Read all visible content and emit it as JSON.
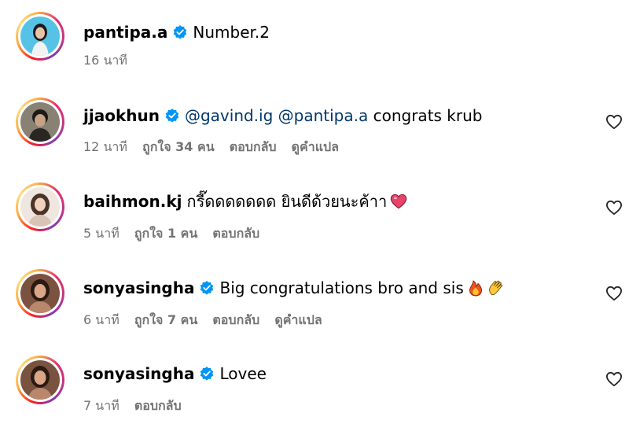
{
  "comments": [
    {
      "username": "pantipa.a",
      "verified": true,
      "mentions": [],
      "text": "Number.2",
      "time": "16 นาที",
      "likes": "",
      "reply": "",
      "translate": "",
      "has_heart": false
    },
    {
      "username": "jjaokhun",
      "verified": true,
      "mention1": "@gavind.ig",
      "mention2": "@pantipa.a",
      "text": "congrats krub",
      "time": "12 นาที",
      "likes": "ถูกใจ 34 คน",
      "reply": "ตอบกลับ",
      "translate": "ดูคำแปล",
      "has_heart": true
    },
    {
      "username": "baihmon.kj",
      "verified": false,
      "text": "กรี๊ดดดดดดด ยินดีด้วยนะค้าา",
      "emoji": "heart-emoji",
      "time": "5 นาที",
      "likes": "ถูกใจ 1 คน",
      "reply": "ตอบกลับ",
      "translate": "",
      "has_heart": true
    },
    {
      "username": "sonyasingha",
      "verified": true,
      "text": "Big congratulations bro and sis",
      "emoji": "fire-emoji, clapping-hands-emoji",
      "time": "6 นาที",
      "likes": "ถูกใจ 7 คน",
      "reply": "ตอบกลับ",
      "translate": "ดูคำแปล",
      "has_heart": true
    },
    {
      "username": "sonyasingha",
      "verified": true,
      "text": "Lovee",
      "time": "7 นาที",
      "likes": "",
      "reply": "ตอบกลับ",
      "translate": "",
      "has_heart": true
    }
  ],
  "colors": {
    "verified_badge": "#0095f6",
    "mention": "#00376b",
    "meta_text": "#737373"
  }
}
